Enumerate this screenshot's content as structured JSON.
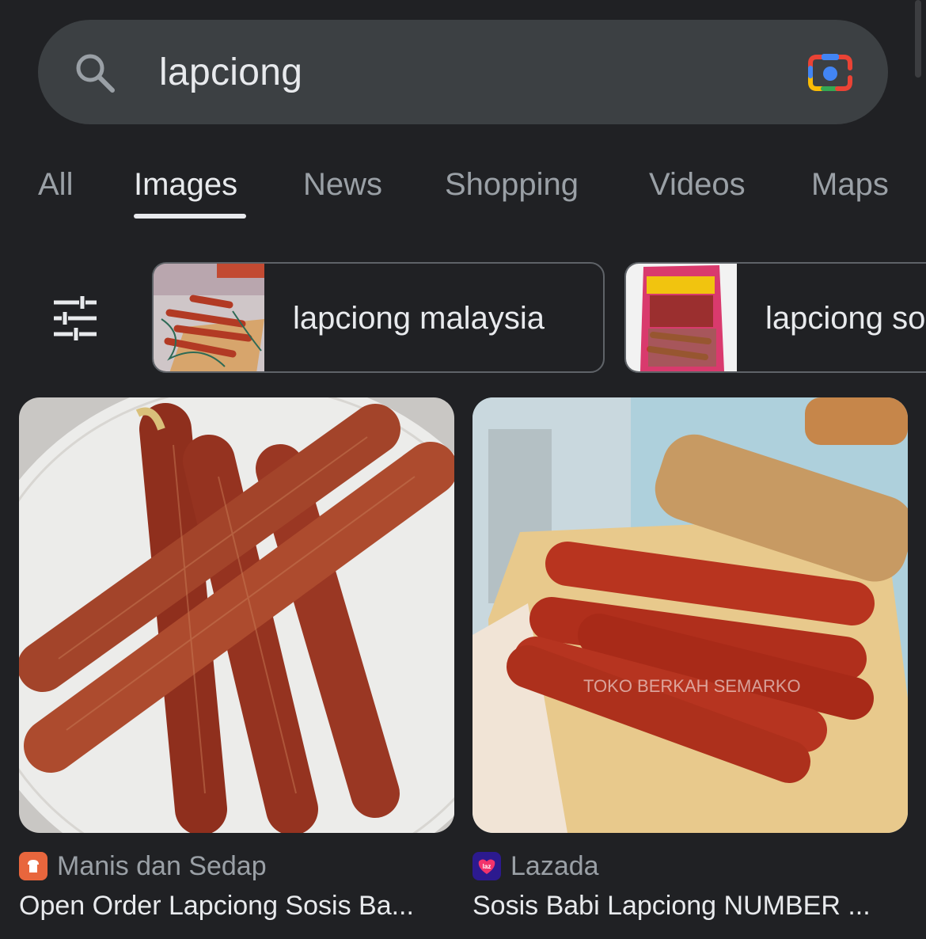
{
  "search": {
    "query": "lapciong"
  },
  "tabs": [
    {
      "label": "All"
    },
    {
      "label": "Images"
    },
    {
      "label": "News"
    },
    {
      "label": "Shopping"
    },
    {
      "label": "Videos"
    },
    {
      "label": "Maps"
    }
  ],
  "active_tab": "Images",
  "suggestions": [
    {
      "label": "lapciong malaysia"
    },
    {
      "label": "lapciong so"
    }
  ],
  "results": [
    {
      "source": "Manis dan Sedap",
      "title": "Open Order Lapciong Sosis Ba...",
      "favicon_color": "#e8663d"
    },
    {
      "source": "Lazada",
      "title": "Sosis Babi Lapciong NUMBER ...",
      "favicon_color": "#2c1a8f",
      "favicon_text": "laz"
    }
  ],
  "image_watermark": "TOKO BERKAH SEMARKO",
  "icons": {
    "search": "search-icon",
    "lens": "google-lens-icon",
    "filter": "tune-icon"
  }
}
